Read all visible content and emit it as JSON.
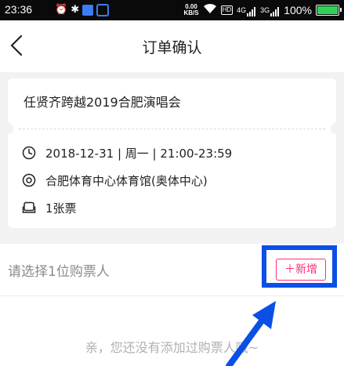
{
  "status_bar": {
    "time": "23:36",
    "speed_value": "0.00",
    "speed_unit": "KB/S",
    "hd": "HD",
    "signal_1": "4G",
    "signal_2": "3G",
    "battery": "100%"
  },
  "nav": {
    "title": "订单确认"
  },
  "event": {
    "title": "任贤齐跨越2019合肥演唱会",
    "datetime": "2018-12-31 | 周一 | 21:00-23:59",
    "venue": "合肥体育中心体育馆(奥体中心)",
    "tickets": "1张票"
  },
  "buyer": {
    "prompt": "请选择1位购票人",
    "add_label": "＋新增",
    "empty_message": "亲，您还没有添加过购票人哦~"
  },
  "colors": {
    "accent": "#ff2d7a",
    "highlight": "#0a4fe6",
    "background": "#f2f2f2"
  }
}
